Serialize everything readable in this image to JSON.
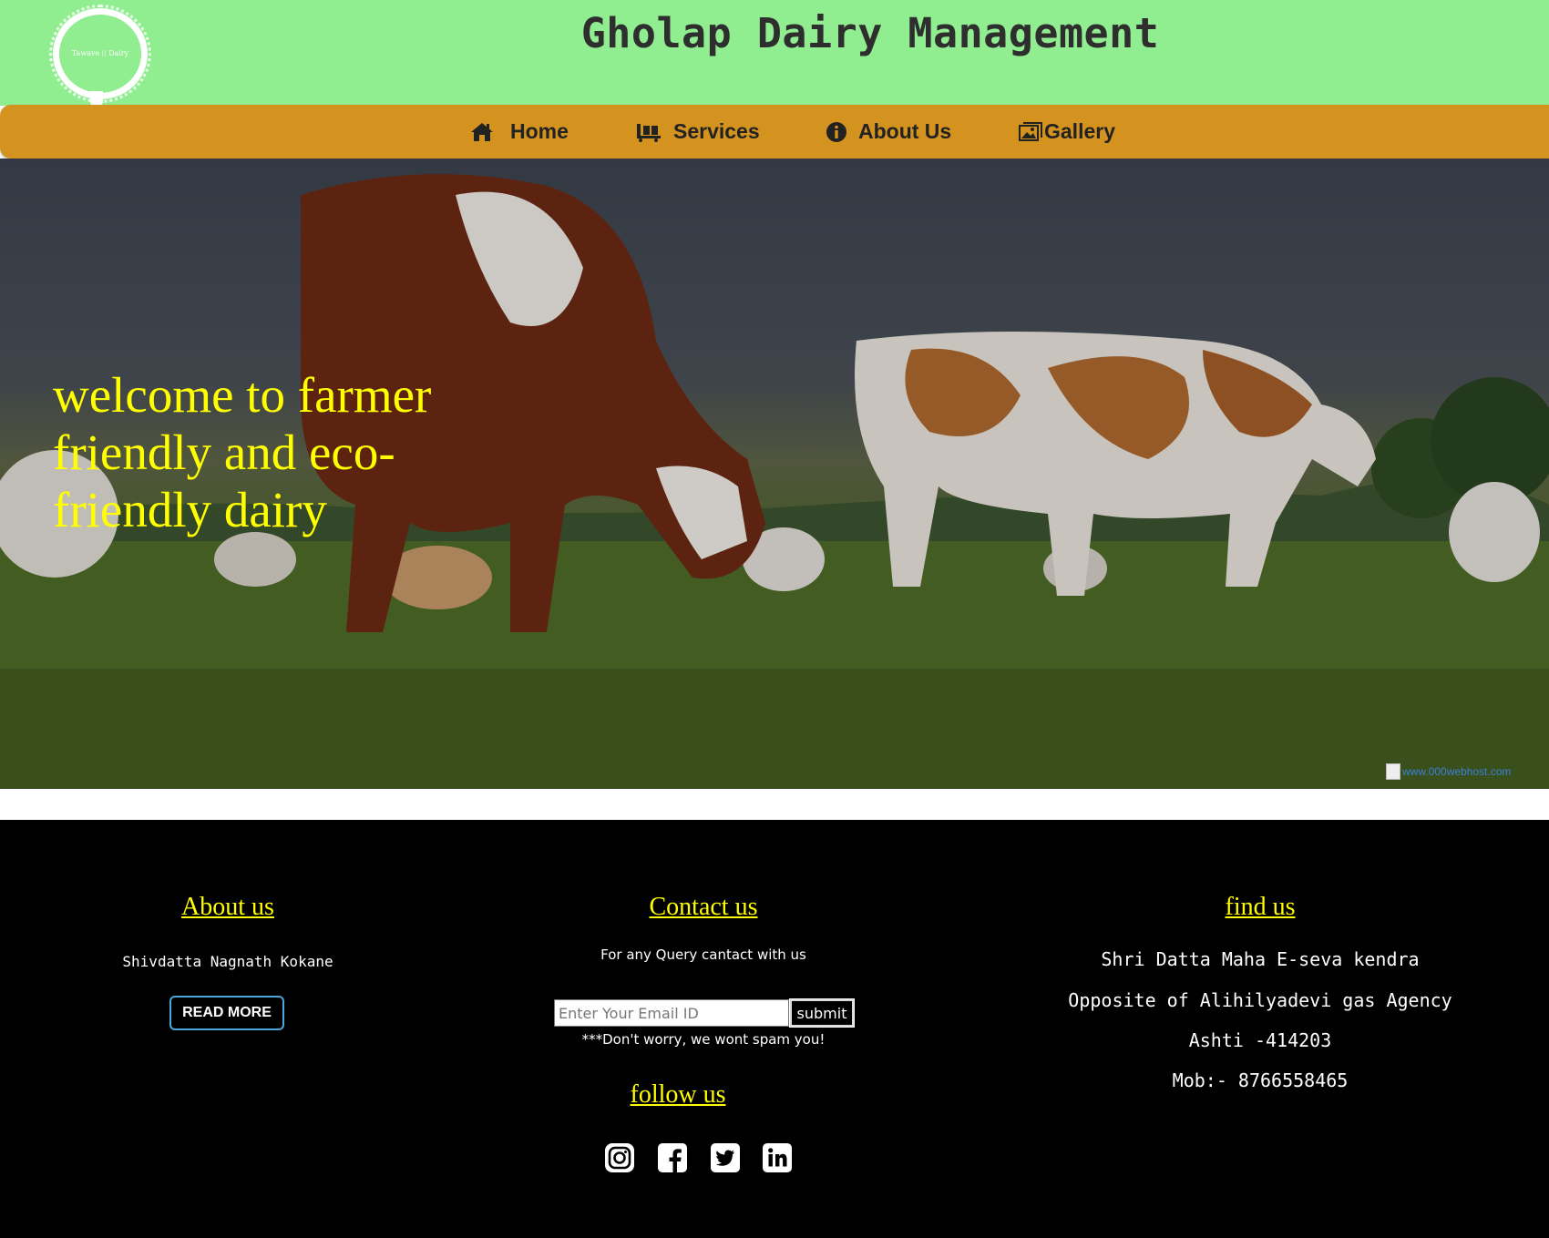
{
  "header": {
    "title": "Gholap Dairy Management",
    "logo_text": "Tawave ⌷ Dairy",
    "background": "#90ee90"
  },
  "nav": {
    "background": "#d4921f",
    "items": [
      {
        "label": "Home",
        "icon": "home-icon"
      },
      {
        "label": "Services",
        "icon": "truck-icon"
      },
      {
        "label": "About Us",
        "icon": "info-icon"
      },
      {
        "label": "Gallery",
        "icon": "gallery-icon"
      }
    ]
  },
  "hero": {
    "headline": "welcome to farmer friendly and eco-friendly dairy",
    "headline_color": "#ffff00",
    "broken_image_alt": "www.000webhost.com"
  },
  "footer": {
    "about": {
      "heading": "About us",
      "name": "Shivdatta Nagnath Kokane",
      "button": "READ MORE"
    },
    "contact": {
      "heading": "Contact us",
      "subtitle": "For any Query cantact with us",
      "email_placeholder": "Enter Your Email ID",
      "submit": "submit",
      "note": "***Don't worry, we wont spam you!"
    },
    "follow": {
      "heading": "follow us",
      "icons": [
        "instagram-icon",
        "facebook-icon",
        "twitter-icon",
        "linkedin-icon"
      ]
    },
    "find": {
      "heading": "find us",
      "lines": [
        "Shri Datta Maha E-seva kendra",
        "Opposite of Alihilyadevi gas Agency",
        "Ashti -414203",
        "Mob:- 8766558465"
      ]
    },
    "heading_color": "#ffff00"
  }
}
